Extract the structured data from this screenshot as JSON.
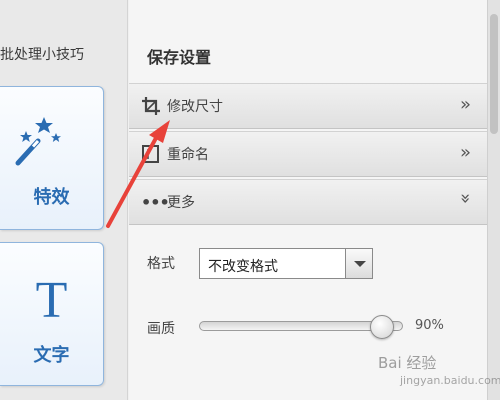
{
  "left_panel": {
    "tips_label": "批处理小技巧",
    "effects_button": {
      "label": "特效",
      "icon": "magic-wand-icon"
    },
    "text_button": {
      "label": "文字",
      "icon": "text-t-icon"
    }
  },
  "right_panel": {
    "title": "保存设置",
    "sections": [
      {
        "label": "修改尺寸",
        "icon": "crop-icon",
        "arrow": "»"
      },
      {
        "label": "重命名",
        "icon": "rename-icon",
        "arrow": "»"
      },
      {
        "label": "更多",
        "icon": "more-dots-icon",
        "arrow": "»"
      }
    ],
    "format": {
      "label": "格式",
      "selected": "不改变格式"
    },
    "quality": {
      "label": "画质",
      "value": 90,
      "value_text": "90%"
    }
  },
  "watermark": {
    "text": "Bai 经验",
    "sub": "jingyan.baidu.com"
  },
  "colors": {
    "accent": "#2a6cb2",
    "annotation_arrow": "#e8423a"
  }
}
